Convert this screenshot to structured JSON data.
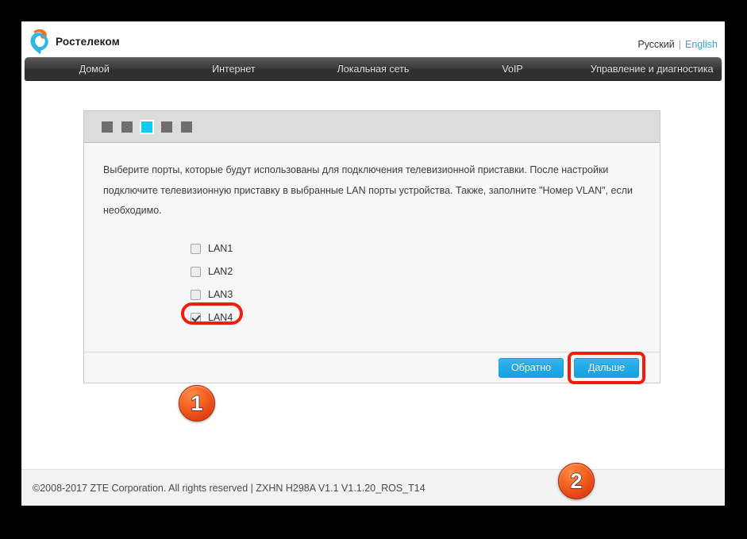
{
  "brand": {
    "name": "Ростелеком",
    "logo_icon": "rostelecom-ear-logo",
    "accent_orange": "#f4701f",
    "accent_cyan": "#2eb7e6"
  },
  "lang": {
    "russian": "Русский",
    "separator": "|",
    "english": "English"
  },
  "nav": {
    "items": [
      {
        "label": "Домой"
      },
      {
        "label": "Интернет"
      },
      {
        "label": "Локальная сеть"
      },
      {
        "label": "VoIP"
      },
      {
        "label": "Управление и диагностика"
      }
    ]
  },
  "wizard": {
    "steps": [
      {
        "state": "inactive"
      },
      {
        "state": "inactive"
      },
      {
        "state": "active"
      },
      {
        "state": "inactive"
      },
      {
        "state": "inactive"
      }
    ],
    "active_step": 3,
    "total_steps": 5,
    "active_color": "#11cbf2",
    "inactive_color": "#6e6e6e",
    "description": "Выберите порты, которые будут использованы для подключения телевизионной приставки. После настройки подключите телевизионную приставку в выбранные LAN порты устройства. Также, заполните \"Номер VLAN\", если необходимо.",
    "ports": [
      {
        "label": "LAN1",
        "checked": false
      },
      {
        "label": "LAN2",
        "checked": false
      },
      {
        "label": "LAN3",
        "checked": false
      },
      {
        "label": "LAN4",
        "checked": true
      }
    ],
    "buttons": {
      "back": "Обратно",
      "next": "Дальше"
    }
  },
  "annotations": {
    "highlight_color": "#f01d0e",
    "badges": [
      {
        "number": "1",
        "target": "lan4-checkbox"
      },
      {
        "number": "2",
        "target": "next-button"
      }
    ]
  },
  "footer": {
    "text": "©2008-2017 ZTE Corporation. All rights reserved  |   ZXHN H298A V1.1 V1.1.20_ROS_T14"
  }
}
